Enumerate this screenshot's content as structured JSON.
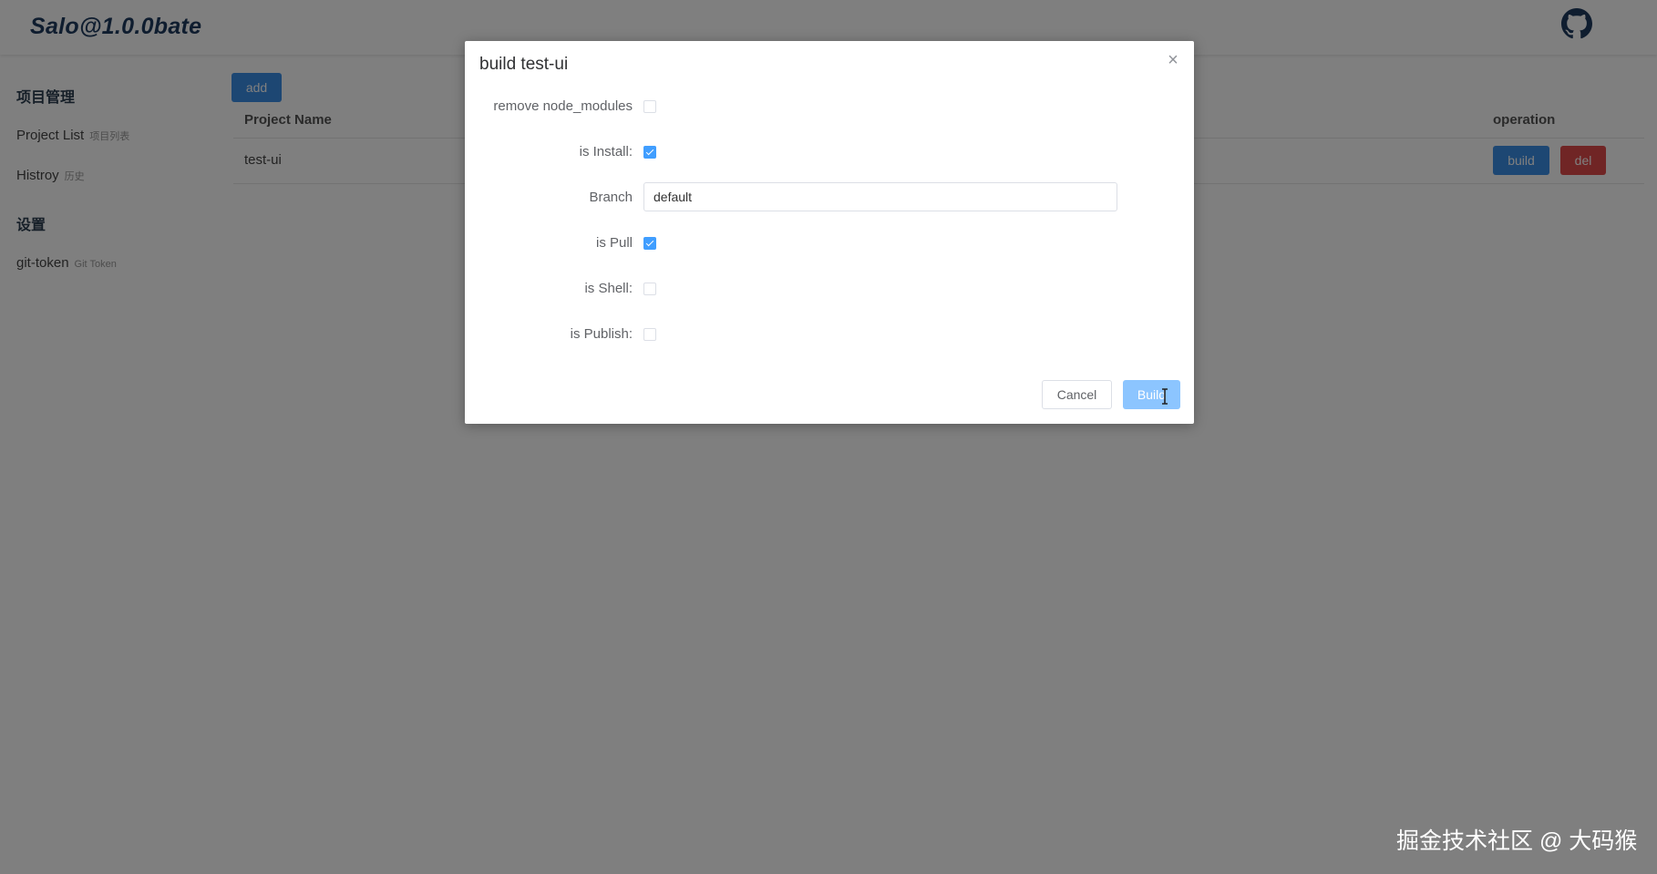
{
  "app": {
    "brand": "Salo@1.0.0bate"
  },
  "header": {
    "icon": "github-icon"
  },
  "sidebar": {
    "groups": [
      {
        "title": "项目管理",
        "items": [
          {
            "label": "Project List",
            "sub": "项目列表"
          },
          {
            "label": "Histroy",
            "sub": "历史"
          }
        ]
      },
      {
        "title": "设置",
        "items": [
          {
            "label": "git-token",
            "sub": "Git Token"
          }
        ]
      }
    ]
  },
  "main": {
    "add_label": "add",
    "table": {
      "columns": [
        "Project Name",
        "operation"
      ],
      "rows": [
        {
          "name": "test-ui",
          "build_label": "build",
          "del_label": "del"
        }
      ]
    }
  },
  "dialog": {
    "title": "build test-ui",
    "close_icon": "close-icon",
    "fields": {
      "remove_node_modules": {
        "label": "remove node_modules",
        "checked": false
      },
      "is_install": {
        "label": "is Install:",
        "checked": true
      },
      "branch": {
        "label": "Branch",
        "value": "default"
      },
      "is_pull": {
        "label": "is Pull",
        "checked": true
      },
      "is_shell": {
        "label": "is Shell:",
        "checked": false
      },
      "is_publish": {
        "label": "is Publish:",
        "checked": false
      }
    },
    "cancel_label": "Cancel",
    "build_label": "Build"
  },
  "colors": {
    "primary": "#3a8ee6",
    "danger": "#e04a4a",
    "checkbox_on": "#409eff",
    "build_disabled": "#8cc5ff"
  },
  "watermark": "掘金技术社区 @ 大码猴"
}
